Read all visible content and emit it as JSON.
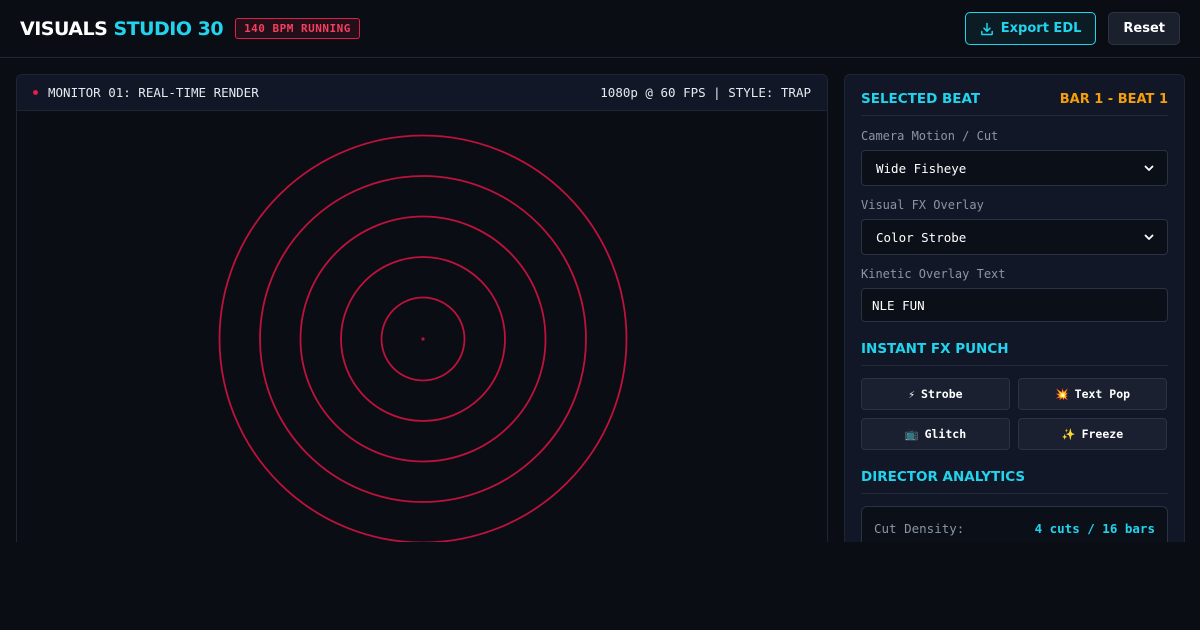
{
  "header": {
    "brand_part1": "VISUALS",
    "brand_part2": "STUDIO 30",
    "bpm_badge": "140 BPM RUNNING",
    "export_label": "Export EDL",
    "reset_label": "Reset"
  },
  "monitor": {
    "title": "MONITOR 01: REAL-TIME RENDER",
    "meta": "1080p @ 60 FPS | STYLE: TRAP",
    "ring_count": 5,
    "ring_color": "#be123c"
  },
  "panel": {
    "selected_beat": {
      "title": "SELECTED BEAT",
      "badge": "BAR 1 - BEAT 1",
      "camera_label": "Camera Motion / Cut",
      "camera_value": "Wide Fisheye",
      "fx_label": "Visual FX Overlay",
      "fx_value": "Color Strobe",
      "text_label": "Kinetic Overlay Text",
      "text_value": "NLE FUN"
    },
    "instant_fx": {
      "title": "INSTANT FX PUNCH",
      "buttons": [
        {
          "icon": "⚡",
          "label": "Strobe"
        },
        {
          "icon": "💥",
          "label": "Text Pop"
        },
        {
          "icon": "📺",
          "label": "Glitch"
        },
        {
          "icon": "✨",
          "label": "Freeze"
        }
      ]
    },
    "analytics": {
      "title": "DIRECTOR ANALYTICS",
      "cut_density_label": "Cut Density:",
      "cut_density_value": "4 cuts / 16 bars"
    }
  },
  "colors": {
    "accent": "#22d3ee",
    "alert": "#e11d48",
    "beat": "#f59e0b"
  }
}
